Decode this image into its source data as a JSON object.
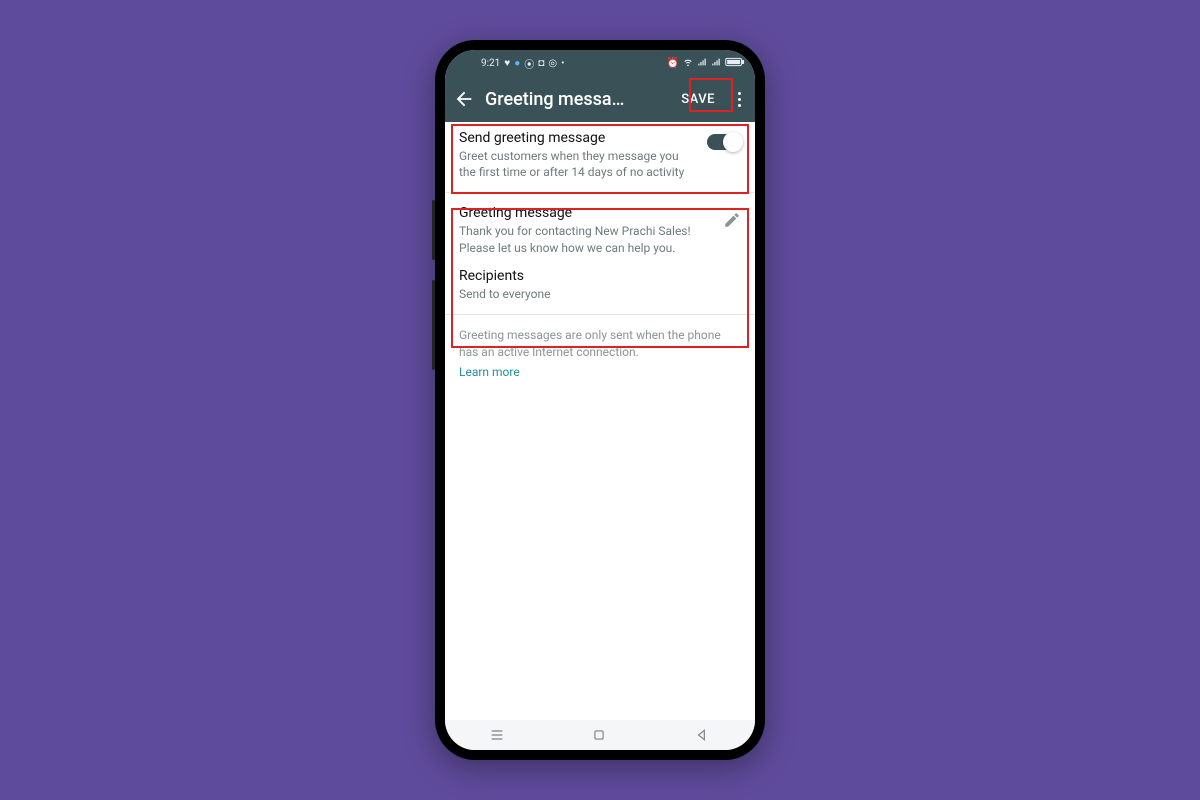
{
  "statusbar": {
    "time": "9:21"
  },
  "appbar": {
    "title": "Greeting messa…",
    "save_label": "SAVE"
  },
  "send_section": {
    "title": "Send greeting message",
    "subtitle": "Greet customers when they message you the first time or after 14 days of no activity",
    "toggle_on": true
  },
  "message_section": {
    "title": "Greeting message",
    "body": "Thank you for contacting New Prachi Sales! Please let us know how we can help you."
  },
  "recipients_section": {
    "title": "Recipients",
    "subtitle": "Send to everyone"
  },
  "footer": {
    "note": "Greeting messages are only sent when the phone has an active Internet connection.",
    "link": "Learn more"
  },
  "colors": {
    "background": "#5f4b9b",
    "appbar": "#3b5158",
    "link": "#1f8f9c",
    "highlight": "#d22"
  }
}
